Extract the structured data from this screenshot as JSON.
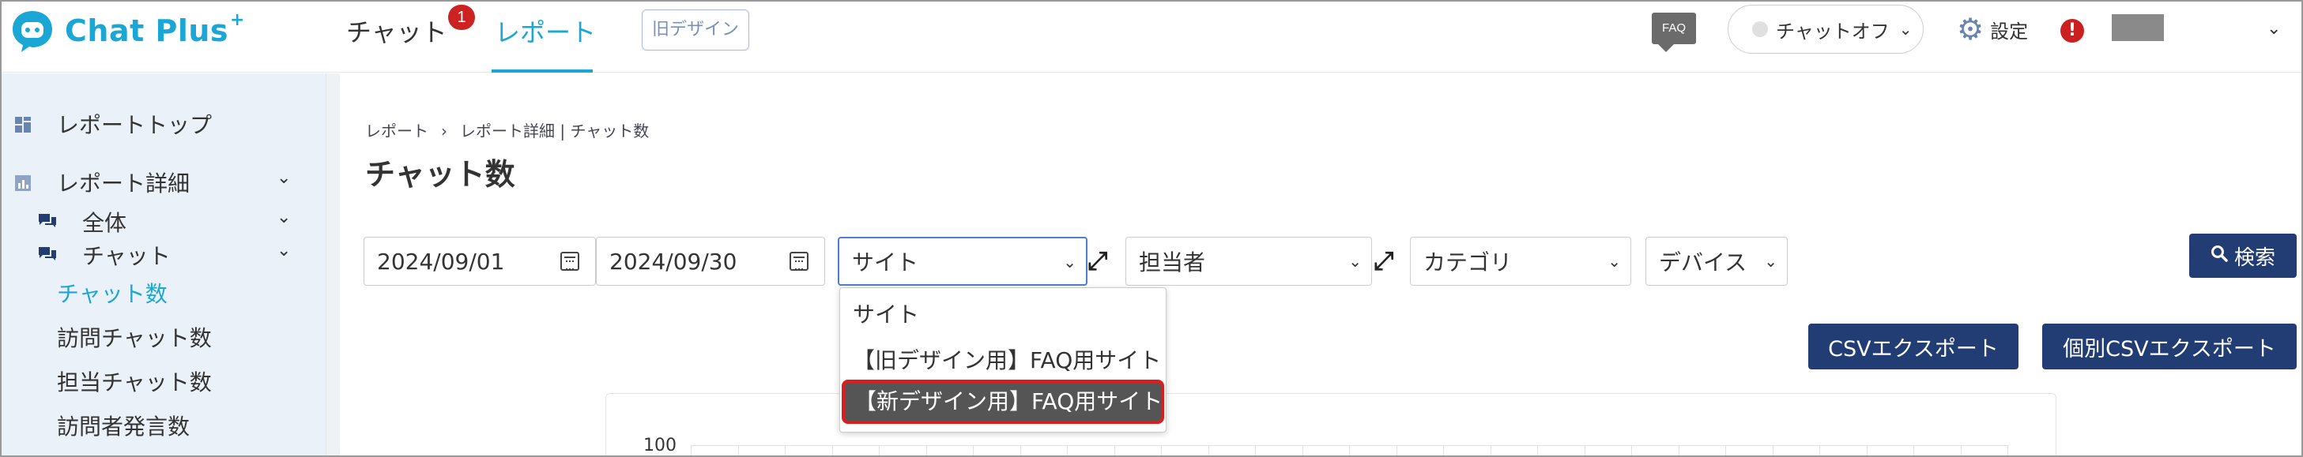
{
  "header": {
    "logo_text": "Chat Plus",
    "logo_plus": "+",
    "nav_chat": "チャット",
    "nav_chat_badge": "1",
    "nav_report": "レポート",
    "old_design": "旧デザイン",
    "faq_icon": "FAQ",
    "chat_status": "チャットオフ",
    "settings_label": "設定",
    "alert": "!"
  },
  "sidebar": {
    "report_top": "レポートトップ",
    "report_detail": "レポート詳細",
    "all": "全体",
    "chat": "チャット",
    "chat_count": "チャット数",
    "visit_chat_count": "訪問チャット数",
    "assignee_chat_count": "担当チャット数",
    "visitor_messages": "訪問者発言数"
  },
  "main": {
    "breadcrumb": [
      "レポート",
      "›",
      "レポート詳細 | チャット数"
    ],
    "title": "チャット数",
    "date_from": "2024/09/01",
    "date_to": "2024/09/30",
    "site_select": "サイト",
    "assignee_select": "担当者",
    "category_select": "カテゴリ",
    "device_select": "デバイス",
    "search_button": "検索",
    "csv_export": "CSVエクスポート",
    "individual_csv_export": "個別CSVエクスポート",
    "chart_y_label": "100"
  },
  "site_dropdown": {
    "options": [
      "サイト",
      "【旧デザイン用】FAQ用サイト",
      "【新デザイン用】FAQ用サイト"
    ],
    "highlighted_index": 2
  },
  "colors": {
    "brand": "#1aa7d6",
    "button": "#223d73",
    "highlight_border": "#e01b1b",
    "badge": "#cc2222"
  }
}
